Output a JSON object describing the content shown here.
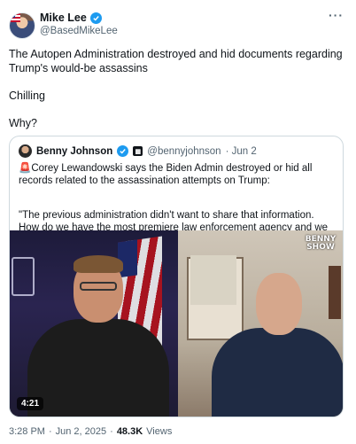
{
  "author": {
    "display_name": "Mike Lee",
    "handle": "@BasedMikeLee"
  },
  "tweet": {
    "line1": "The Autopen Administration destroyed and hid documents regarding Trump's would-be assassins",
    "line2": "Chilling",
    "line3": "Why?"
  },
  "quote": {
    "display_name": "Benny Johnson",
    "handle": "@bennyjohnson",
    "date": "· Jun 2",
    "siren": "🚨",
    "text1": "Corey Lewandowski says the Biden Admin destroyed or hid all records related to the assassination attempts on Trump:",
    "text2": "\"The previous administration didn't want to share that information. How do we have the most premiere law enforcement agency and we haven't seen a ...",
    "video": {
      "duration": "4:21",
      "logo_line1": "BENNY",
      "logo_line2": "SHOW"
    }
  },
  "footer": {
    "time": "3:28 PM",
    "date": "Jun 2, 2025",
    "sep1": "·",
    "sep2": "·",
    "views_count": "48.3K",
    "views_label": "Views"
  },
  "icons": {
    "more": "more-icon",
    "verified": "verified-icon"
  },
  "colors": {
    "accent": "#1d9bf0",
    "muted": "#536471"
  }
}
